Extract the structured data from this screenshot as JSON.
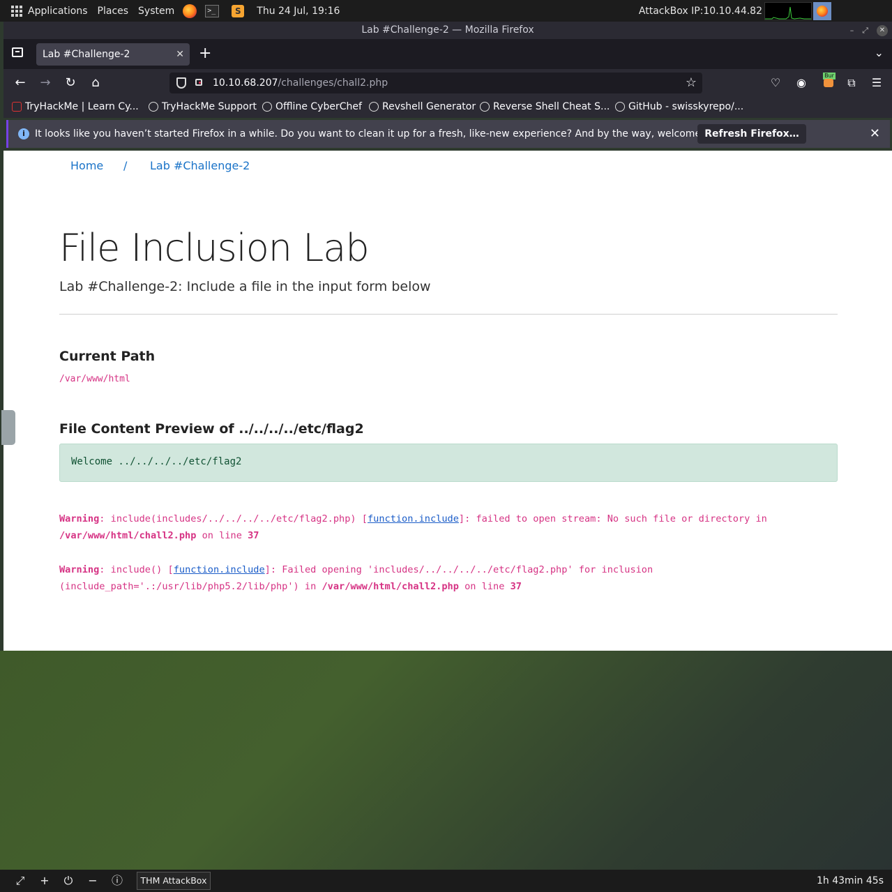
{
  "system_panel": {
    "applications": "Applications",
    "places": "Places",
    "system": "System",
    "datetime": "Thu 24 Jul, 19:16",
    "attackbox_ip": "AttackBox IP:10.10.44.82"
  },
  "window": {
    "title": "Lab #Challenge-2 — Mozilla Firefox"
  },
  "tabs": [
    {
      "label": "Lab #Challenge-2"
    }
  ],
  "urlbar": {
    "host": "10.10.68.207",
    "path": "/challenges/chall2.php"
  },
  "bookmarks": [
    {
      "label": "TryHackMe | Learn Cy...",
      "icon": "tryhackme-icon"
    },
    {
      "label": "TryHackMe Support",
      "icon": "cloud-icon"
    },
    {
      "label": "Offline CyberChef",
      "icon": "chef-icon"
    },
    {
      "label": "Revshell Generator",
      "icon": "globe-icon"
    },
    {
      "label": "Reverse Shell Cheat S...",
      "icon": "globe-icon"
    },
    {
      "label": "GitHub - swisskyrepo/...",
      "icon": "github-icon"
    }
  ],
  "notification": {
    "message": "It looks like you haven’t started Firefox in a while. Do you want to clean it up for a fresh, like-new experience? And by the way, welcome back!",
    "button": "Refresh Firefox…"
  },
  "page": {
    "breadcrumb": {
      "home": "Home",
      "sep": "/",
      "current": "Lab #Challenge-2"
    },
    "title": "File Inclusion Lab",
    "lead": "Lab #Challenge-2: Include a file in the input form below",
    "current_path_heading": "Current Path",
    "current_path": "/var/www/html",
    "preview_heading": "File Content Preview of ../../../../etc/flag2",
    "preview_text": "Welcome ../../../../etc/flag2",
    "warnings": [
      {
        "label": "Warning",
        "pre": ": include(includes/../../../../etc/flag2.php) [",
        "link": "function.include",
        "post": "]: failed to open stream: No such file or directory in ",
        "file": "/var/www/html/chall2.php",
        "on_line": " on line ",
        "line": "37"
      },
      {
        "label": "Warning",
        "pre": ": include() [",
        "link": "function.include",
        "post": "]: Failed opening 'includes/../../../../etc/flag2.php' for inclusion (include_path='.:/usr/lib/php5.2/lib/php') in ",
        "file": "/var/www/html/chall2.php",
        "on_line": " on line ",
        "line": "37"
      }
    ]
  },
  "bottom_bar": {
    "task": "THM AttackBox",
    "timer": "1h 43min 45s"
  }
}
